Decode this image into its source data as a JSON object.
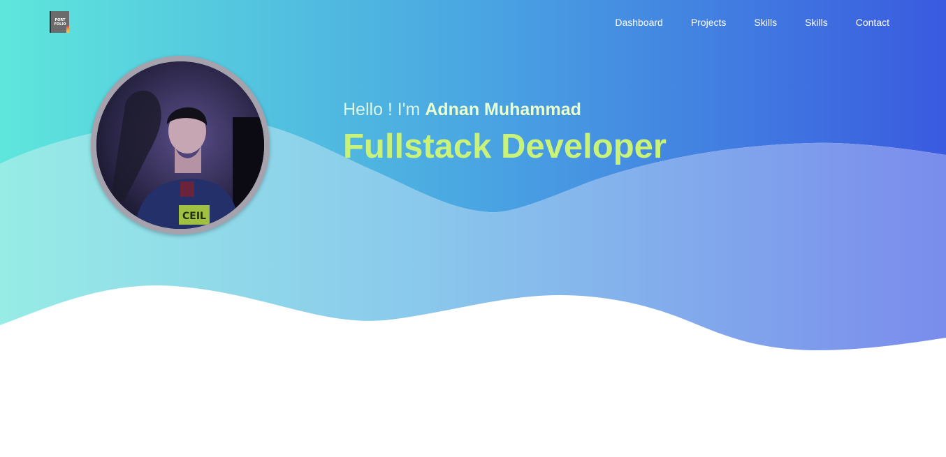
{
  "logo": {
    "line1": "PORT",
    "line2": "FOLIO"
  },
  "nav": {
    "items": [
      {
        "label": "Dashboard"
      },
      {
        "label": "Projects"
      },
      {
        "label": "Skills"
      },
      {
        "label": "Skills"
      },
      {
        "label": "Contact"
      }
    ]
  },
  "hero": {
    "greeting_prefix": "Hello ! I'm",
    "name": "Adnan Muhammad",
    "role": "Fullstack Developer"
  },
  "colors": {
    "gradient_start": "#5ee6dc",
    "gradient_end": "#3a5ae0",
    "name_color": "#e8ffd0",
    "role_color": "#c8f27a"
  }
}
